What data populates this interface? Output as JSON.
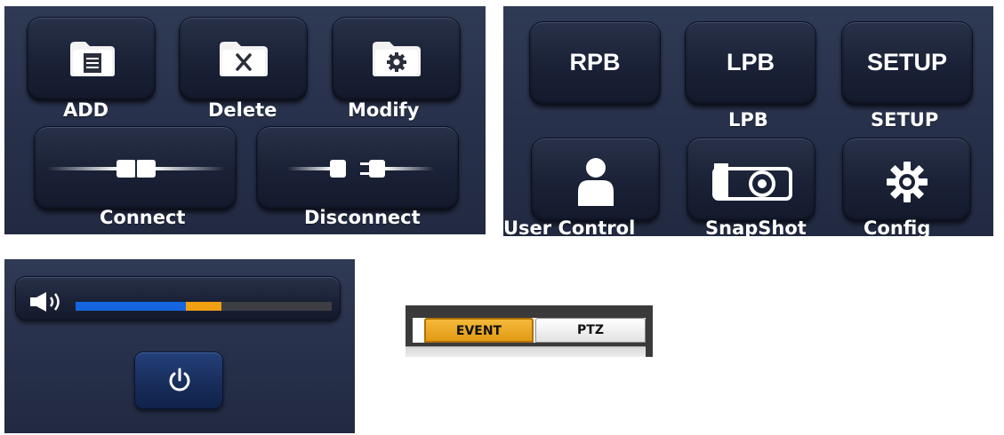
{
  "file_panel": {
    "add_label": "ADD",
    "delete_label": "Delete",
    "modify_label": "Modify",
    "connect_label": "Connect",
    "disconnect_label": "Disconnect"
  },
  "playback_panel": {
    "rpb_button": "RPB",
    "lpb_button": "LPB",
    "setup_button": "SETUP",
    "lpb_label": "LPB",
    "setup_label": "SETUP",
    "user_control_label": "User Control",
    "snapshot_label": "SnapShot",
    "config_label": "Config"
  },
  "volume_panel": {
    "icon": "speaker-icon",
    "level_blue": 0.43,
    "level_orange": 0.14,
    "colors": {
      "blue": "#1565e0",
      "orange": "#f0a010",
      "track": "#3d3e43"
    },
    "power_icon": "power-icon"
  },
  "tabs": {
    "items": [
      {
        "label": "EVENT",
        "selected": true
      },
      {
        "label": "PTZ",
        "selected": false
      }
    ],
    "colors": {
      "selected": "#e29a14",
      "unselected": "#e2e2e2"
    }
  }
}
